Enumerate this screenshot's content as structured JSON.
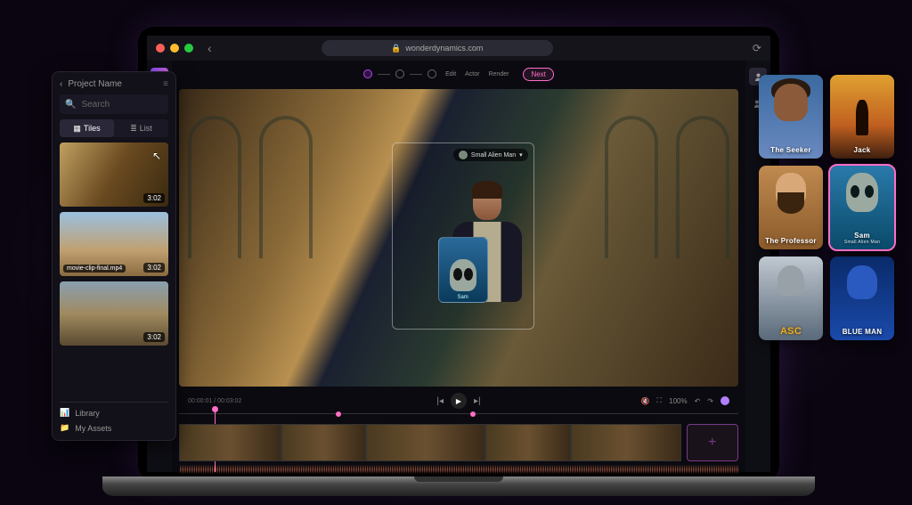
{
  "browser": {
    "url": "wonderdynamics.com"
  },
  "sidebar": {
    "back_label": "Project Name",
    "search_placeholder": "Search",
    "tabs": {
      "tiles": "Tiles",
      "list": "List"
    },
    "items": [
      {
        "duration": "3:02"
      },
      {
        "filename": "movie-clip-final.mp4",
        "duration": "3:02"
      },
      {
        "duration": "3:02"
      }
    ],
    "footer": {
      "library": "Library",
      "my_assets": "My Assets"
    }
  },
  "workflow": {
    "steps": [
      "Edit",
      "Actor",
      "Render"
    ],
    "next_label": "Next"
  },
  "viewport": {
    "character_tag": "Small Alien Man",
    "drop_card_label": "Sam"
  },
  "controls": {
    "timecode": "00:00:01 / 00:03:02",
    "zoom": "100%"
  },
  "characters": [
    {
      "name": "The Seeker",
      "id": "seeker"
    },
    {
      "name": "Jack",
      "id": "sunset"
    },
    {
      "name": "The Professor",
      "id": "prof"
    },
    {
      "name": "Sam",
      "sub": "Small Alien Man",
      "id": "sam",
      "selected": true
    },
    {
      "name": "ASC",
      "id": "asc"
    },
    {
      "name": "BLUE MAN",
      "id": "blue"
    }
  ]
}
